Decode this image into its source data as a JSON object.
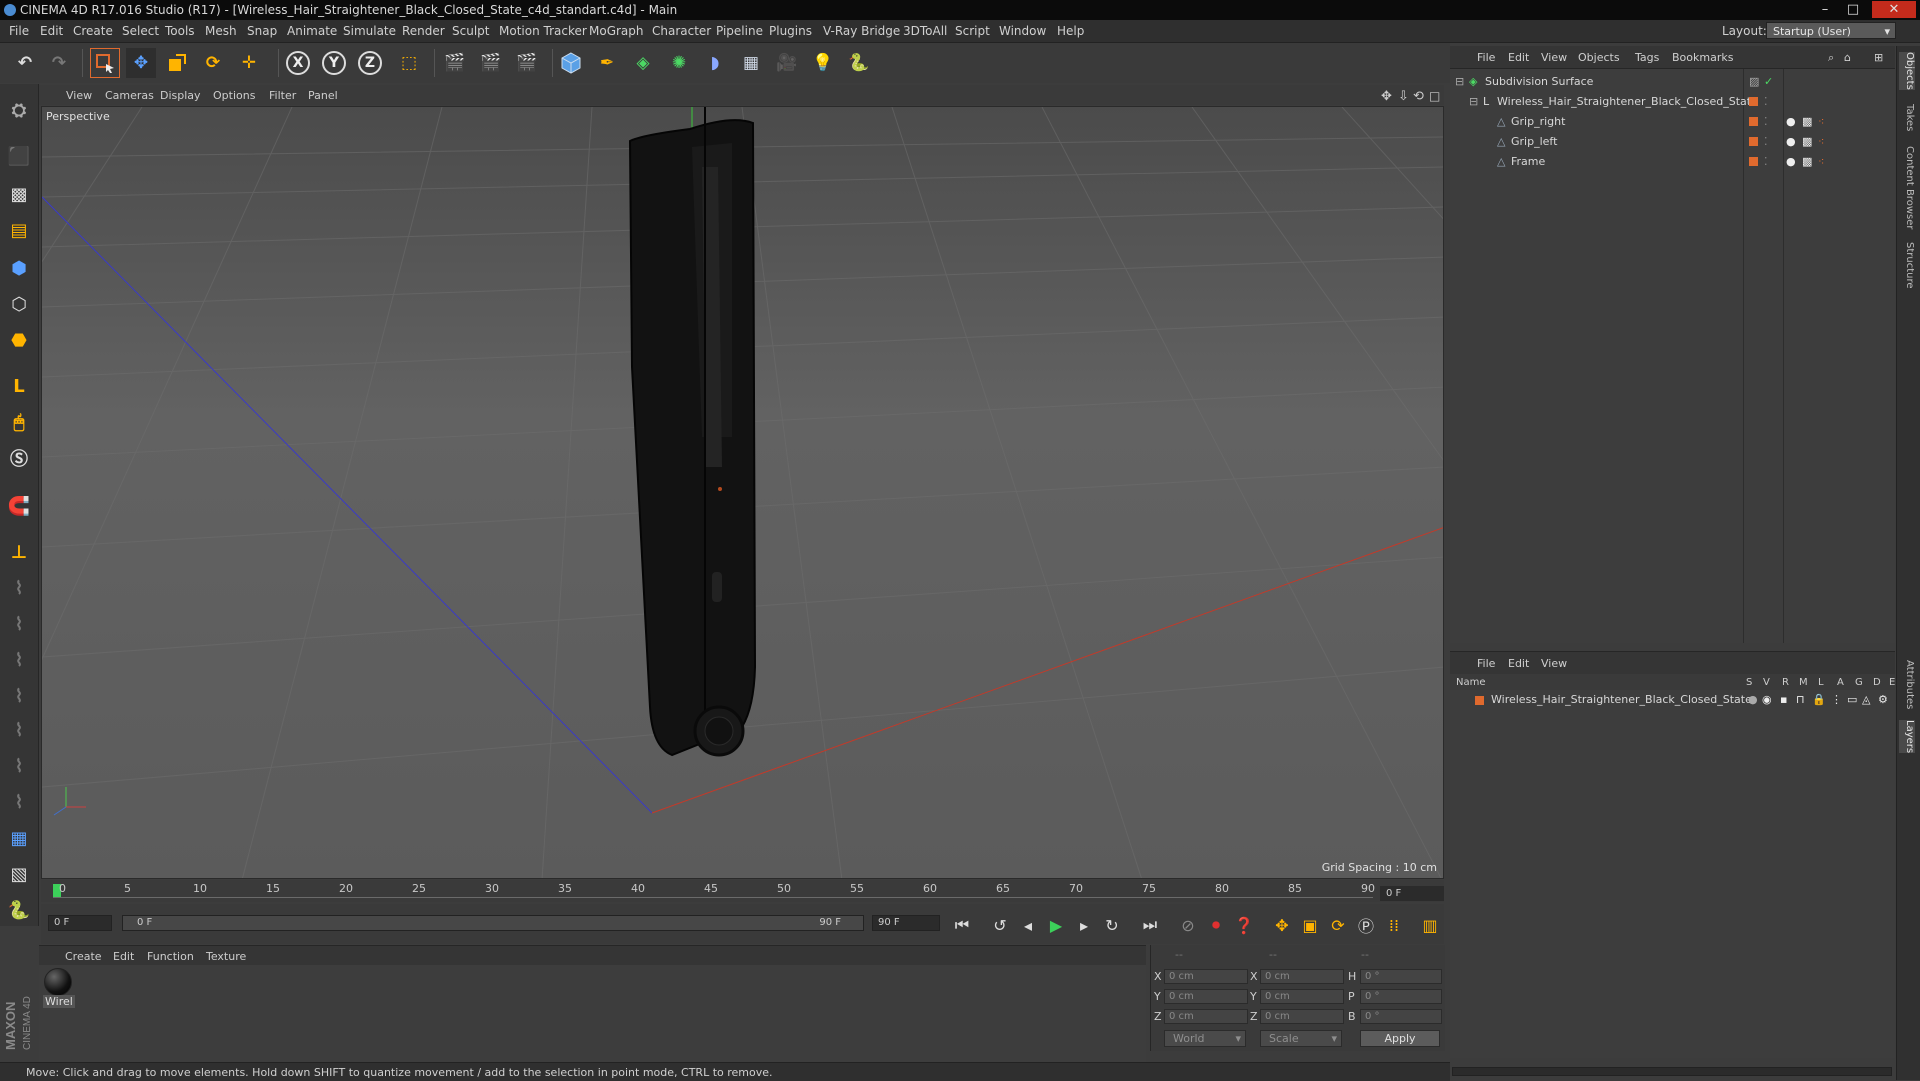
{
  "window": {
    "title": "CINEMA 4D R17.016 Studio (R17) - [Wireless_Hair_Straightener_Black_Closed_State_c4d_standart.c4d] - Main",
    "minimize": "–",
    "maximize": "□",
    "close": "✕"
  },
  "menu": [
    "File",
    "Edit",
    "Create",
    "Select",
    "Tools",
    "Mesh",
    "Snap",
    "Animate",
    "Simulate",
    "Render",
    "Sculpt",
    "Motion Tracker",
    "MoGraph",
    "Character",
    "Pipeline",
    "Plugins",
    "V-Ray Bridge",
    "3DToAll",
    "Script",
    "Window",
    "Help"
  ],
  "layout": {
    "label": "Layout:",
    "value": "Startup (User)"
  },
  "toolbar": {
    "axis_x": "X",
    "axis_y": "Y",
    "axis_z": "Z"
  },
  "viewport": {
    "menu": [
      "View",
      "Cameras",
      "Display",
      "Options",
      "Filter",
      "Panel"
    ],
    "label": "Perspective",
    "grid_spacing": "Grid Spacing : 10 cm"
  },
  "timeline": {
    "ticks": [
      "0",
      "5",
      "10",
      "15",
      "20",
      "25",
      "30",
      "35",
      "40",
      "45",
      "50",
      "55",
      "60",
      "65",
      "70",
      "75",
      "80",
      "85",
      "90"
    ],
    "current_frame": "0 F",
    "start_field": "0 F",
    "range_start": "0 F",
    "range_end": "90 F",
    "end_field": "90 F"
  },
  "material_manager": {
    "menu": [
      "Create",
      "Edit",
      "Function",
      "Texture"
    ],
    "materials": [
      {
        "label": "Wirel"
      }
    ]
  },
  "coordinates": {
    "headers": [
      "--",
      "--",
      "--"
    ],
    "rows": [
      {
        "l1": "X",
        "v1": "0 cm",
        "l2": "X",
        "v2": "0 cm",
        "l3": "H",
        "v3": "0 °"
      },
      {
        "l1": "Y",
        "v1": "0 cm",
        "l2": "Y",
        "v2": "0 cm",
        "l3": "P",
        "v3": "0 °"
      },
      {
        "l1": "Z",
        "v1": "0 cm",
        "l2": "Z",
        "v2": "0 cm",
        "l3": "B",
        "v3": "0 °"
      }
    ],
    "mode": "World",
    "scale": "Scale",
    "apply": "Apply"
  },
  "status": "Move: Click and drag to move elements. Hold down SHIFT to quantize movement / add to the selection in point mode, CTRL to remove.",
  "object_manager": {
    "menu": [
      "File",
      "Edit",
      "View",
      "Objects",
      "Tags",
      "Bookmarks"
    ],
    "objects": [
      {
        "name": "Subdivision Surface"
      },
      {
        "name": "Wireless_Hair_Straightener_Black_Closed_State"
      },
      {
        "name": "Grip_right"
      },
      {
        "name": "Grip_left"
      },
      {
        "name": "Frame"
      }
    ]
  },
  "layer_manager": {
    "menu": [
      "File",
      "Edit",
      "View"
    ],
    "columns": [
      "Name",
      "S",
      "V",
      "R",
      "M",
      "L",
      "A",
      "G",
      "D",
      "E"
    ],
    "layers": [
      {
        "name": "Wireless_Hair_Straightener_Black_Closed_State"
      }
    ]
  },
  "right_tabs": [
    "Objects",
    "Takes",
    "Content Browser",
    "Structure",
    "Attributes",
    "Layers"
  ],
  "colors": {
    "accent": "#e06a2e",
    "grid_x": "#c23a2a",
    "grid_z": "#3a3ac8",
    "grid_y": "#3ac83a"
  }
}
